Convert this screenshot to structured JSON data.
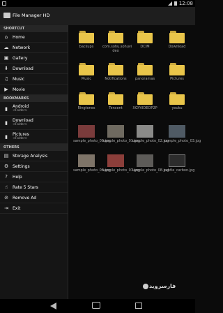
{
  "statusbar": {
    "time": "12:08"
  },
  "app": {
    "title": "File Manager HD"
  },
  "drawer": {
    "shortcut_header": "SHORTCUT",
    "shortcuts": [
      {
        "label": "Home",
        "icon": "home-icon"
      },
      {
        "label": "Network",
        "icon": "network-icon"
      },
      {
        "label": "Gallery",
        "icon": "gallery-icon"
      },
      {
        "label": "Download",
        "icon": "download-icon"
      },
      {
        "label": "Music",
        "icon": "music-icon"
      },
      {
        "label": "Movie",
        "icon": "movie-icon"
      }
    ],
    "bookmarks_header": "BOOKMARKS",
    "bookmarks": [
      {
        "label": "Android",
        "sub": "<Folder>",
        "icon": "bookmark-icon"
      },
      {
        "label": "Download",
        "sub": "<Folder>",
        "icon": "bookmark-icon"
      },
      {
        "label": "Pictures",
        "sub": "<Folder>",
        "icon": "bookmark-icon"
      }
    ],
    "others_header": "OTHERS",
    "others": [
      {
        "label": "Storage Analysis",
        "icon": "storage-analysis-icon"
      },
      {
        "label": "Settings",
        "icon": "gear-icon"
      },
      {
        "label": "Help",
        "icon": "help-icon"
      },
      {
        "label": "Rate 5 Stars",
        "icon": "thumbs-up-icon"
      },
      {
        "label": "Remove Ad",
        "icon": "remove-ad-icon"
      },
      {
        "label": "Exit",
        "icon": "exit-icon"
      }
    ]
  },
  "files": [
    {
      "name": "backups"
    },
    {
      "name": "com.sohu.sohuvi deo"
    },
    {
      "name": "DCIM"
    },
    {
      "name": "Download"
    },
    {
      "name": "Music"
    },
    {
      "name": "Notifications"
    },
    {
      "name": "panoramas"
    },
    {
      "name": "Pictures"
    },
    {
      "name": "Ringtones"
    },
    {
      "name": "Tencent"
    },
    {
      "name": "XGYVIDEOP2P"
    },
    {
      "name": "youku"
    },
    {
      "name": "sample_photo_00.jpg"
    },
    {
      "name": "sample_photo_01.jpg"
    },
    {
      "name": "sample_photo_02.jpg"
    },
    {
      "name": "sample_photo_03.jpg"
    },
    {
      "name": "sample_photo_06.jpg"
    },
    {
      "name": "sample_photo_07.jpg"
    },
    {
      "name": "sample_photo_08.jpg"
    },
    {
      "name": "subtle_carbon.jpg"
    }
  ],
  "watermark": "فارسروید"
}
